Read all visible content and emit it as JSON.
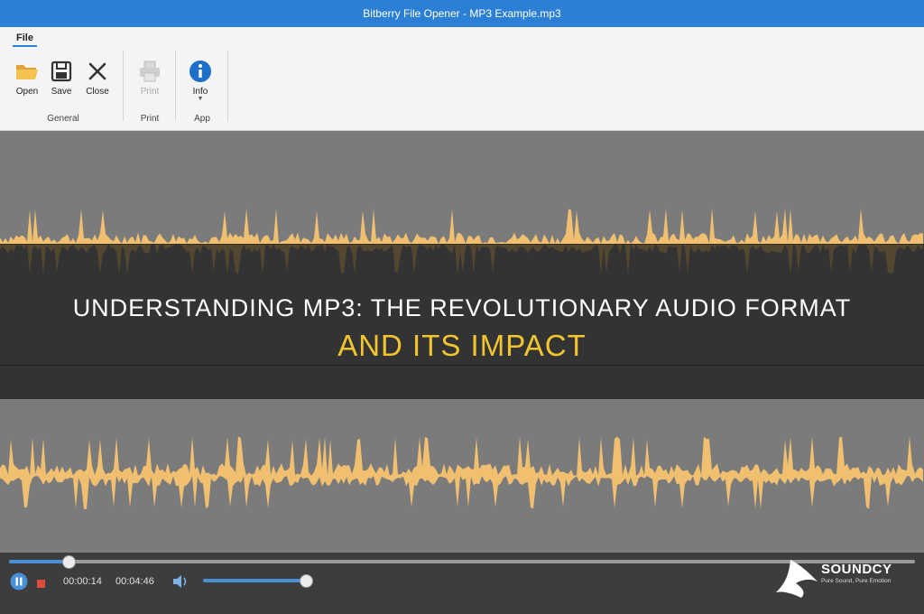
{
  "window": {
    "title": "Bitberry File Opener - MP3 Example.mp3"
  },
  "ribbon": {
    "tab": "File",
    "buttons": {
      "open": "Open",
      "save": "Save",
      "close": "Close",
      "print": "Print",
      "info": "Info"
    },
    "groups": {
      "general": "General",
      "print": "Print",
      "app": "App"
    }
  },
  "banner": {
    "line1": "UNDERSTANDING MP3: THE REVOLUTIONARY AUDIO FORMAT",
    "line2": "AND ITS IMPACT"
  },
  "player": {
    "elapsed": "00:00:14",
    "duration": "00:04:46",
    "progress_fraction": 0.065,
    "volume_fraction": 1.0,
    "state": "playing"
  },
  "logo": {
    "name": "SOUNDCY",
    "tagline": "Pure Sound, Pure Emotion"
  },
  "colors": {
    "titlebar": "#2b7fd4",
    "waveform": "#f0c070",
    "waveform_bg": "#7b7b7b",
    "accent": "#4a90d9",
    "banner_highlight": "#f2c530"
  },
  "icons": {
    "open": "folder-icon",
    "save": "floppy-disk-icon",
    "close": "x-icon",
    "print": "printer-icon",
    "info": "info-circle-icon",
    "pause": "pause-icon",
    "stop": "stop-icon",
    "volume": "speaker-icon"
  }
}
